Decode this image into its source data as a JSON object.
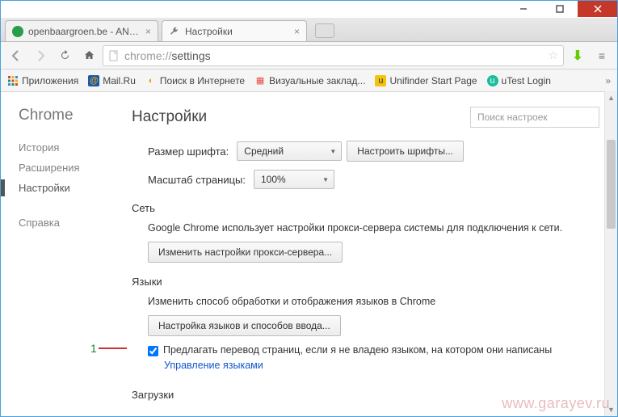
{
  "window": {
    "min": "—",
    "max": "▢",
    "close": "✕"
  },
  "tabs": [
    {
      "label": "openbaargroen.be - ANRG",
      "favicon_color": "#2a9d4a"
    },
    {
      "label": "Настройки",
      "favicon": "wrench"
    }
  ],
  "omnibox": {
    "scheme": "chrome://",
    "path": "settings"
  },
  "bookmarks": {
    "apps": "Приложения",
    "items": [
      {
        "label": "Mail.Ru",
        "color": "#f5a623",
        "glyph": "@"
      },
      {
        "label": "Поиск в Интернете",
        "color": "#f39c12",
        "glyph": "◐"
      },
      {
        "label": "Визуальные заклад...",
        "color": "#e74c3c",
        "glyph": "▦"
      },
      {
        "label": "Unifinder Start Page",
        "color": "#f1c40f",
        "glyph": "u"
      },
      {
        "label": "uTest Login",
        "color": "#1abc9c",
        "glyph": "u"
      }
    ]
  },
  "sidebar": {
    "brand": "Chrome",
    "items": [
      {
        "label": "История",
        "active": false
      },
      {
        "label": "Расширения",
        "active": false
      },
      {
        "label": "Настройки",
        "active": true
      },
      {
        "label": "Справка",
        "active": false
      }
    ]
  },
  "main": {
    "title": "Настройки",
    "search_placeholder": "Поиск настроек",
    "font_label": "Размер шрифта:",
    "font_value": "Средний",
    "font_button": "Настроить шрифты...",
    "zoom_label": "Масштаб страницы:",
    "zoom_value": "100%",
    "net_title": "Сеть",
    "net_text": "Google Chrome использует настройки прокси-сервера системы для подключения к сети.",
    "net_button": "Изменить настройки прокси-сервера...",
    "lang_title": "Языки",
    "lang_text": "Изменить способ обработки и отображения языков в Chrome",
    "lang_button": "Настройка языков и способов ввода...",
    "lang_checkbox": "Предлагать перевод страниц, если я не владею языком, на котором они написаны",
    "lang_link": "Управление языками",
    "dl_title": "Загрузки"
  },
  "annotation": {
    "num": "1"
  },
  "watermark": "www.garayev.ru"
}
